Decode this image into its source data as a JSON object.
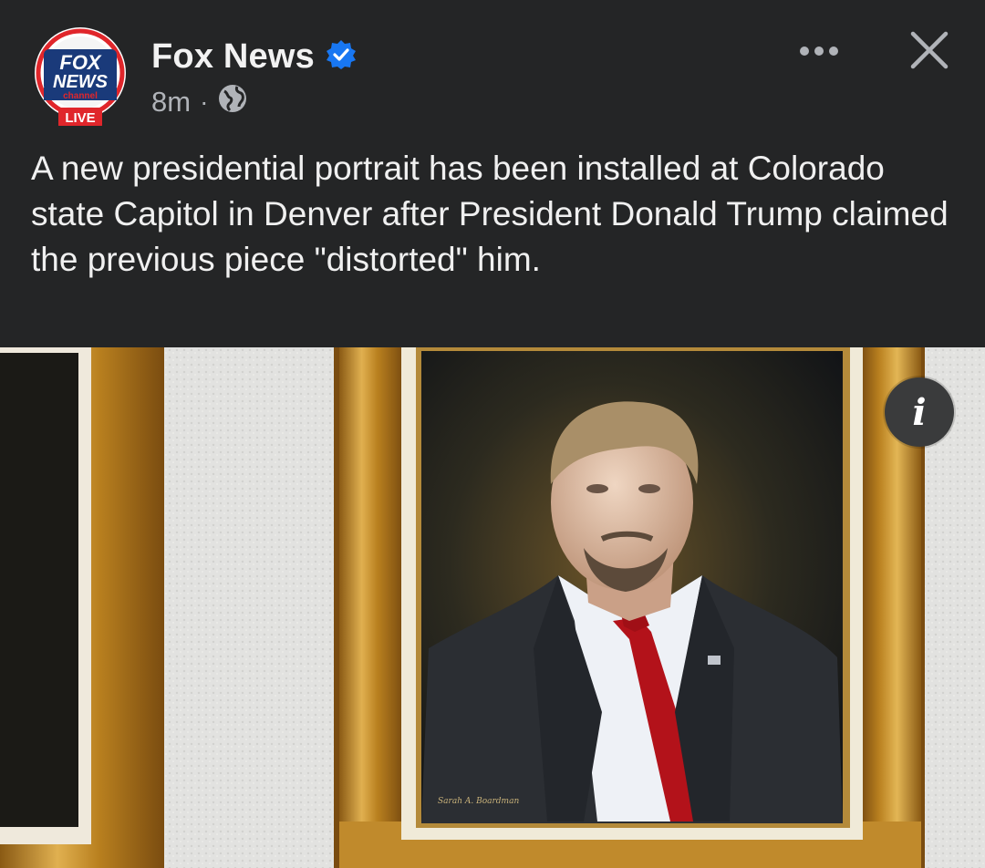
{
  "post": {
    "page_name": "Fox News",
    "verified_icon": "verified-badge-icon",
    "timestamp": "8m",
    "separator": "·",
    "audience_icon": "globe-icon",
    "more_icon": "more-options-icon",
    "close_icon": "close-icon",
    "caption": "A new presidential portrait has been installed at Colorado state Capitol in Denver after President Donald Trump claimed the previous piece \"distorted\" him."
  },
  "avatar": {
    "logo_text_1": "FOX",
    "logo_text_2": "NEWS",
    "logo_text_3": "channel",
    "live_badge": "LIVE",
    "ring_color": "#e0262b",
    "logo_blue": "#1a3a7a"
  },
  "photo": {
    "subject": "framed painted portrait of a man in a dark suit and red tie on a white textured wall",
    "signature": "Sarah A. Boardman",
    "info_icon": "info-icon",
    "info_glyph": "i"
  },
  "colors": {
    "background": "#242526",
    "verified_blue": "#1877f2",
    "secondary_text": "#b0b3b8",
    "frame_gold": "#c9963a",
    "tie_red": "#b3121a"
  }
}
